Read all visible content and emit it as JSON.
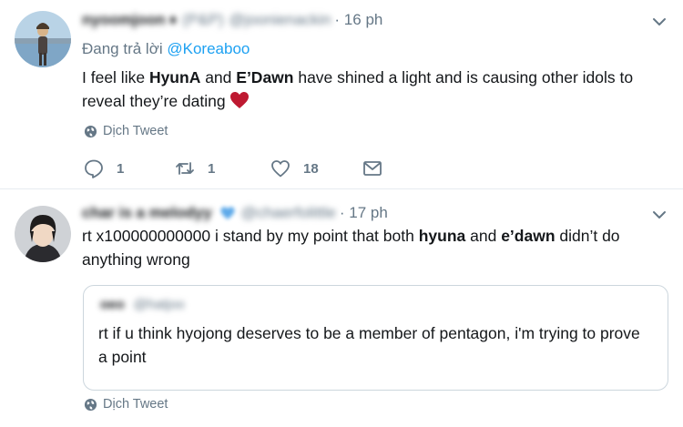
{
  "tweets": [
    {
      "display_name": "nyoomjoon",
      "badge": "♦",
      "handle_extra": "(P&P)",
      "handle": "@joonienackin",
      "time": "· 16 ph",
      "reply_prefix": "Đang trả lời",
      "reply_mention": "@Koreaboo",
      "text_parts": [
        "I feel like ",
        "HyunA",
        " and ",
        "E’Dawn",
        " have shined a light and is causing other idols to reveal they’re dating"
      ],
      "translate_label": "Dịch Tweet",
      "reply_count": "1",
      "retweet_count": "1",
      "like_count": "18"
    },
    {
      "display_name": "char is a melodyy",
      "handle": "@chaerfolittle",
      "time": "· 17 ph",
      "text_parts": [
        "rt x100000000000 i stand by my point that both ",
        "hyuna",
        " and ",
        "e’dawn",
        " didn’t do anything wrong"
      ],
      "quote": {
        "display_name": "oeo",
        "handle": "@hatjoo",
        "text": "rt if u think hyojong deserves to be a member of pentagon, i'm trying to prove a point"
      },
      "translate_label": "Dịch Tweet"
    }
  ],
  "colors": {
    "link": "#1da1f2",
    "secondary_text": "#657786",
    "heart": "#be1931",
    "border": "#e6ecf0"
  }
}
